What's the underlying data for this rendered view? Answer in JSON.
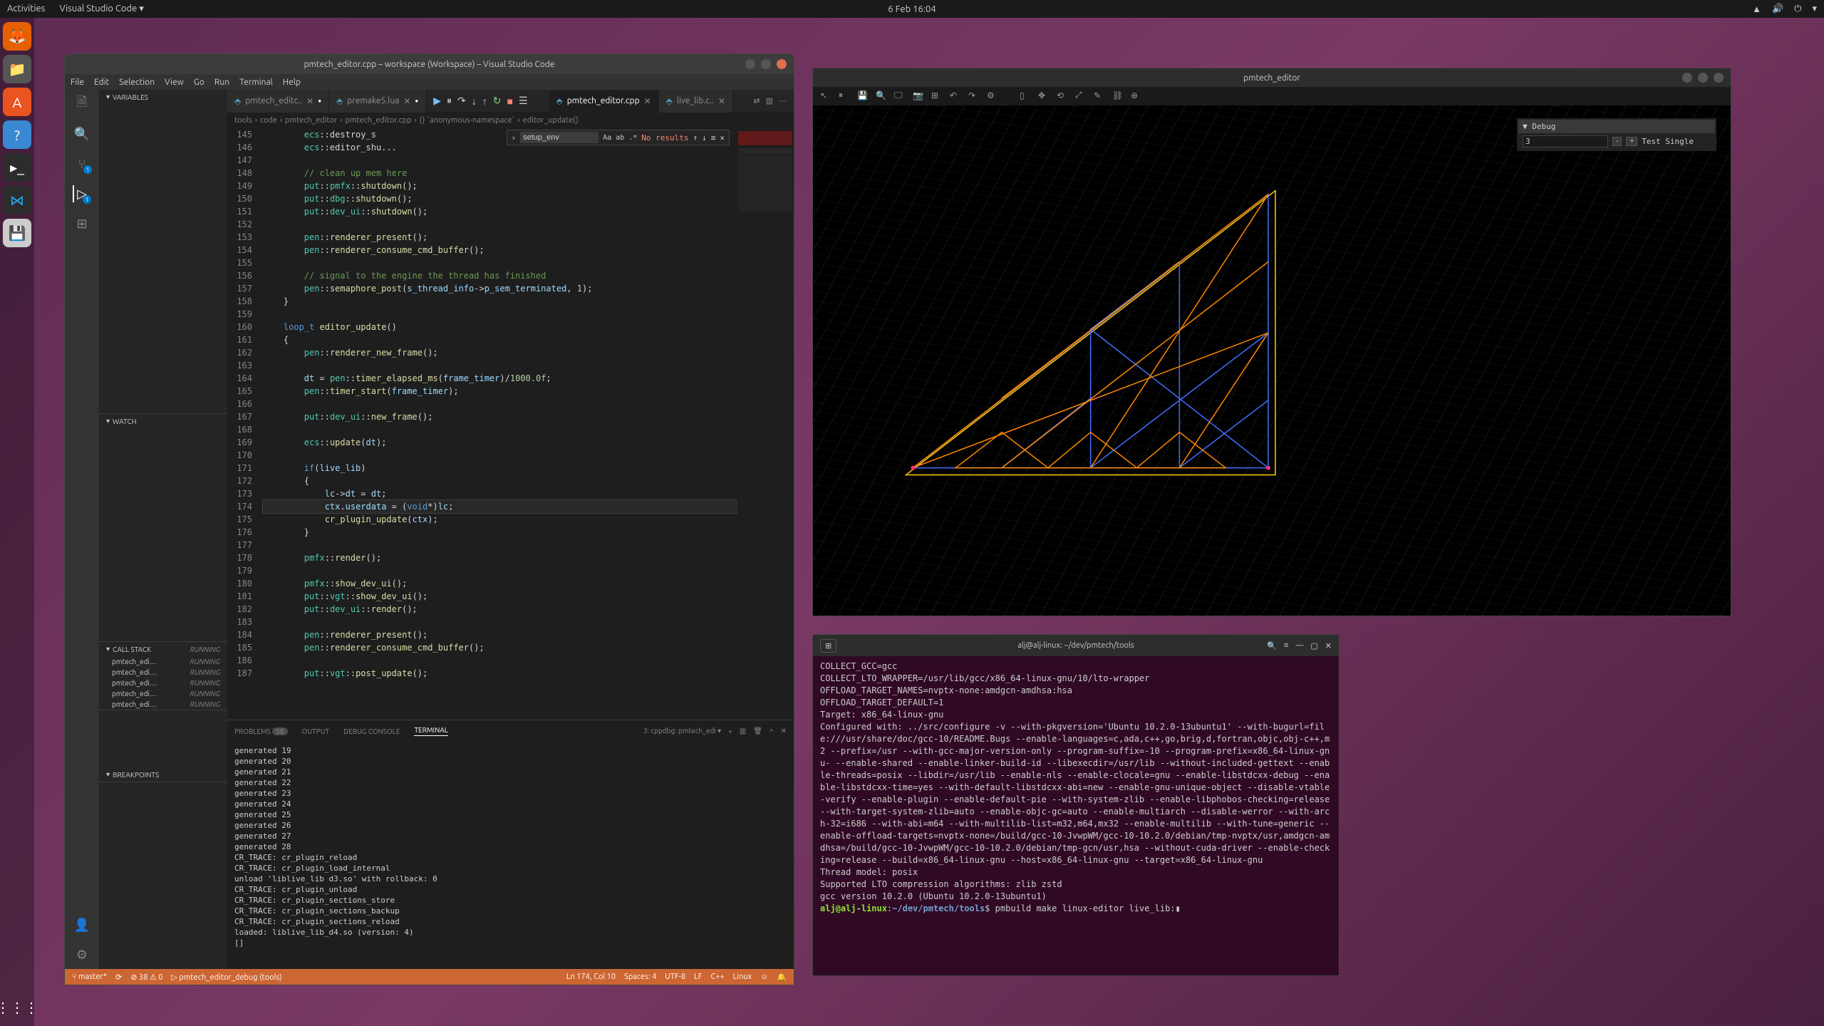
{
  "topbar": {
    "activities": "Activities",
    "app": "Visual Studio Code ▾",
    "datetime": "6 Feb   16:04"
  },
  "vscode": {
    "title": "pmtech_editor.cpp – workspace (Workspace) – Visual Studio Code",
    "menu": [
      "File",
      "Edit",
      "Selection",
      "View",
      "Go",
      "Run",
      "Terminal",
      "Help"
    ],
    "tabs": [
      {
        "name": "pmtech_editc..",
        "active": false,
        "dot": true
      },
      {
        "name": "premake5.lua",
        "active": false,
        "dot": true
      }
    ],
    "tabs2": [
      {
        "name": "pmtech_editor.cpp",
        "active": true
      },
      {
        "name": "live_lib.c..",
        "active": false
      }
    ],
    "breadcrumb": [
      "tools",
      "code",
      "pmtech_editor",
      "pmtech_editor.cpp",
      "{} `anonymous-namespace`",
      "editor_update()"
    ],
    "find": {
      "value": "setup_env",
      "results": "No results"
    },
    "line_start": 145,
    "code": [
      "        ecs::destroy_s",
      "        ecs::editor_shu...",
      "",
      "        // clean up mem here",
      "        put::pmfx::shutdown();",
      "        put::dbg::shutdown();",
      "        put::dev_ui::shutdown();",
      "",
      "        pen::renderer_present();",
      "        pen::renderer_consume_cmd_buffer();",
      "",
      "        // signal to the engine the thread has finished",
      "        pen::semaphore_post(s_thread_info->p_sem_terminated, 1);",
      "    }",
      "",
      "    loop_t editor_update()",
      "    {",
      "        pen::renderer_new_frame();",
      "",
      "        dt = pen::timer_elapsed_ms(frame_timer)/1000.0f;",
      "        pen::timer_start(frame_timer);",
      "",
      "        put::dev_ui::new_frame();",
      "",
      "        ecs::update(dt);",
      "",
      "        if(live_lib)",
      "        {",
      "            lc->dt = dt;",
      "            ctx.userdata = (void*)lc;",
      "            cr_plugin_update(ctx);",
      "        }",
      "",
      "        pmfx::render();",
      "",
      "        pmfx::show_dev_ui();",
      "        put::vgt::show_dev_ui();",
      "        put::dev_ui::render();",
      "",
      "        pen::renderer_present();",
      "        pen::renderer_consume_cmd_buffer();",
      "",
      "        put::vgt::post_update();"
    ],
    "sidebar": {
      "variables": "VARIABLES",
      "watch": "WATCH",
      "callstack": "CALL STACK",
      "callstack_status": "RUNNING",
      "threads": [
        {
          "name": "pmtech_edi…",
          "state": "RUNNING"
        },
        {
          "name": "pmtech_edi…",
          "state": "RUNNING"
        },
        {
          "name": "pmtech_edi…",
          "state": "RUNNING"
        },
        {
          "name": "pmtech_edi…",
          "state": "RUNNING"
        },
        {
          "name": "pmtech_edi…",
          "state": "RUNNING"
        }
      ],
      "breakpoints": "BREAKPOINTS"
    },
    "panel": {
      "tabs": [
        "PROBLEMS",
        "OUTPUT",
        "DEBUG CONSOLE",
        "TERMINAL"
      ],
      "problems_badge": "58",
      "active": "TERMINAL",
      "dropdown": "3: cppdbg: pmtech_edi ▾",
      "output": "generated 19\ngenerated 20\ngenerated 21\ngenerated 22\ngenerated 23\ngenerated 24\ngenerated 25\ngenerated 26\ngenerated 27\ngenerated 28\nCR_TRACE: cr_plugin_reload\nCR_TRACE: cr_plugin_load_internal\nunload 'liblive_lib d3.so' with rollback: 0\nCR_TRACE: cr_plugin_unload\nCR_TRACE: cr_plugin_sections_store\nCR_TRACE: cr_plugin_sections_backup\nCR_TRACE: cr_plugin_sections_reload\nloaded: liblive_lib_d4.so (version: 4)\n[]"
    },
    "status": {
      "branch": "master*",
      "errors": "⊘ 38 ⚠ 0",
      "debug": "pmtech_editor_debug (tools)",
      "pos": "Ln 174, Col 10",
      "spaces": "Spaces: 4",
      "enc": "UTF-8",
      "eol": "LF",
      "lang": "C++",
      "os": "Linux"
    }
  },
  "gl": {
    "title": "pmtech_editor",
    "debug_header": "▼ Debug",
    "debug_value": "3",
    "debug_label": "Test Single"
  },
  "term": {
    "title": "alj@alj-linux: ~/dev/pmtech/tools",
    "body": "COLLECT_GCC=gcc\nCOLLECT_LTO_WRAPPER=/usr/lib/gcc/x86_64-linux-gnu/10/lto-wrapper\nOFFLOAD_TARGET_NAMES=nvptx-none:amdgcn-amdhsa:hsa\nOFFLOAD_TARGET_DEFAULT=1\nTarget: x86_64-linux-gnu\nConfigured with: ../src/configure -v --with-pkgversion='Ubuntu 10.2.0-13ubuntu1' --with-bugurl=file:///usr/share/doc/gcc-10/README.Bugs --enable-languages=c,ada,c++,go,brig,d,fortran,objc,obj-c++,m2 --prefix=/usr --with-gcc-major-version-only --program-suffix=-10 --program-prefix=x86_64-linux-gnu- --enable-shared --enable-linker-build-id --libexecdir=/usr/lib --without-included-gettext --enable-threads=posix --libdir=/usr/lib --enable-nls --enable-clocale=gnu --enable-libstdcxx-debug --enable-libstdcxx-time=yes --with-default-libstdcxx-abi=new --enable-gnu-unique-object --disable-vtable-verify --enable-plugin --enable-default-pie --with-system-zlib --enable-libphobos-checking=release --with-target-system-zlib=auto --enable-objc-gc=auto --enable-multiarch --disable-werror --with-arch-32=i686 --with-abi=m64 --with-multilib-list=m32,m64,mx32 --enable-multilib --with-tune=generic --enable-offload-targets=nvptx-none=/build/gcc-10-JvwpWM/gcc-10-10.2.0/debian/tmp-nvptx/usr,amdgcn-amdhsa=/build/gcc-10-JvwpWM/gcc-10-10.2.0/debian/tmp-gcn/usr,hsa --without-cuda-driver --enable-checking=release --build=x86_64-linux-gnu --host=x86_64-linux-gnu --target=x86_64-linux-gnu\nThread model: posix\nSupported LTO compression algorithms: zlib zstd\ngcc version 10.2.0 (Ubuntu 10.2.0-13ubuntu1)",
    "prompt_user": "alj@alj-linux",
    "prompt_path": "~/dev/pmtech/tools",
    "prompt_cmd": "pmbuild make linux-editor live_lib:"
  }
}
